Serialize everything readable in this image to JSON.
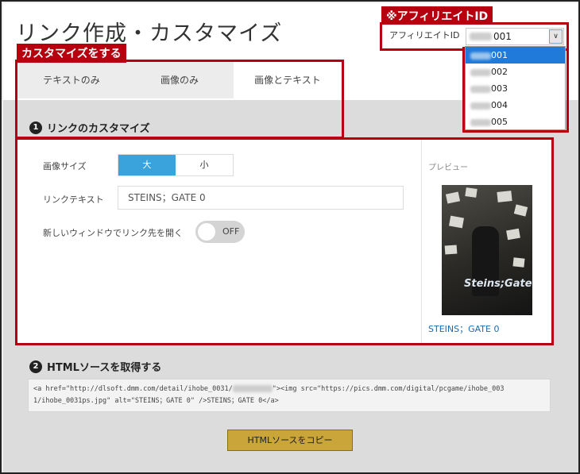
{
  "page": {
    "title": "リンク作成・カスタマイズ"
  },
  "callouts": {
    "customize": "カスタマイズをする",
    "affiliate": "※アフィリエイトID"
  },
  "tabs": [
    {
      "label": "テキストのみ"
    },
    {
      "label": "画像のみ"
    },
    {
      "label": "画像とテキスト"
    }
  ],
  "section1": {
    "number": "1",
    "title": "リンクのカスタマイズ"
  },
  "form": {
    "image_size_label": "画像サイズ",
    "size_options": [
      "大",
      "小"
    ],
    "size_selected": "大",
    "link_text_label": "リンクテキスト",
    "link_text_value": "STEINS；GATE 0",
    "new_window_label": "新しいウィンドウでリンク先を開く",
    "new_window_state": "OFF"
  },
  "preview": {
    "label": "プレビュー",
    "link_text": "STEINS；GATE 0",
    "logo_text": "Steins;Gate"
  },
  "section2": {
    "number": "2",
    "title": "HTMLソースを取得する"
  },
  "code": {
    "line1_a": "<a href=\"http://dlsoft.dmm.com/detail/ihobe_0031/",
    "line1_b": "\"><img src=\"https://pics.dmm.com/digital/pcgame/ihobe_003",
    "line2": "1/ihobe_0031ps.jpg\" alt=\"STEINS；GATE 0\" />STEINS；GATE 0</a>"
  },
  "copy_button": "HTMLソースをコピー",
  "affiliate": {
    "label": "アフィリエイトID",
    "selected": "001",
    "options": [
      "001",
      "002",
      "003",
      "004",
      "005"
    ]
  },
  "colors": {
    "callout": "#b6000f",
    "accent": "#3aa3dc",
    "link": "#1a6bb5",
    "button": "#caa53a"
  }
}
